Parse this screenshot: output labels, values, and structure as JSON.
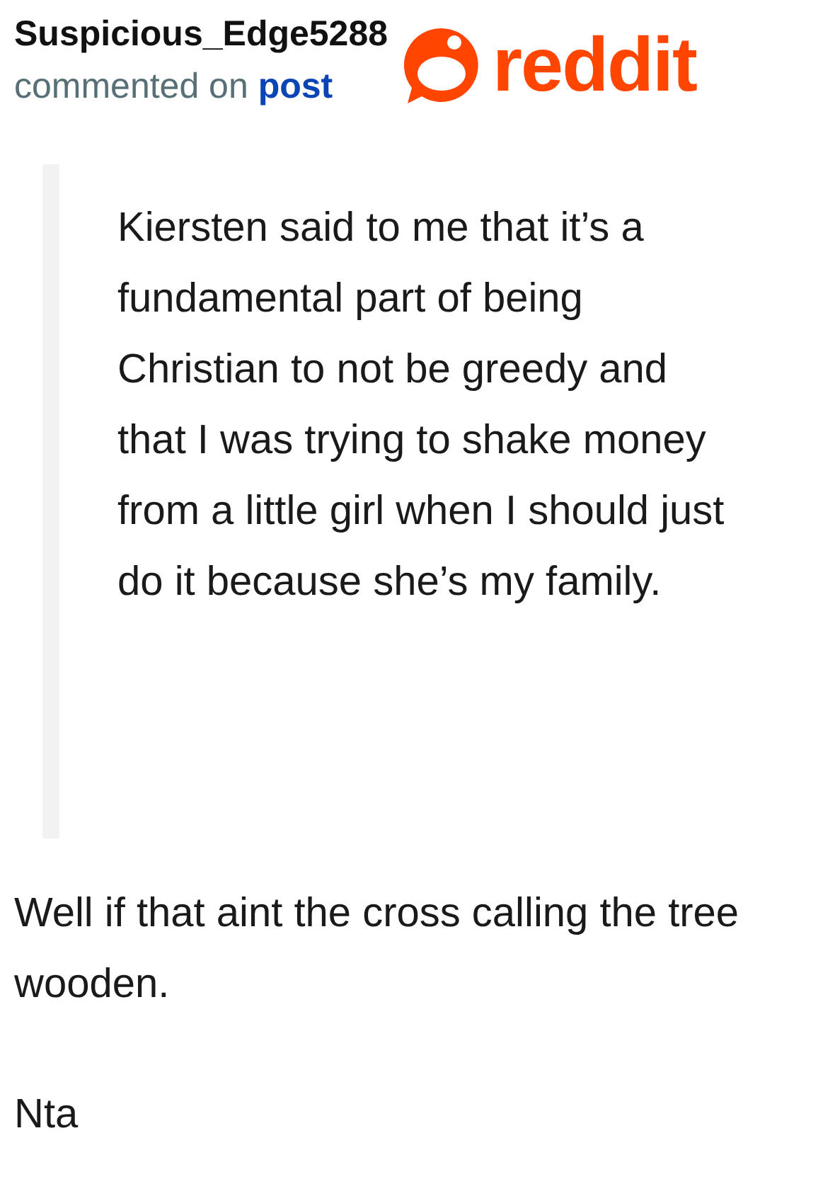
{
  "comment": {
    "author": "Suspicious_Edge5288",
    "action": "commented on",
    "link": "post"
  },
  "logo": {
    "wordmark": "reddit"
  },
  "quote": "Kiersten said to me that it’s a fundamental part of being Christian to not be greedy and that I was trying to shake money from a little girl when I should just do it because she’s my family.",
  "paragraphs": [
    "Well if that aint the cross calling the tree wooden.",
    "Nta"
  ]
}
